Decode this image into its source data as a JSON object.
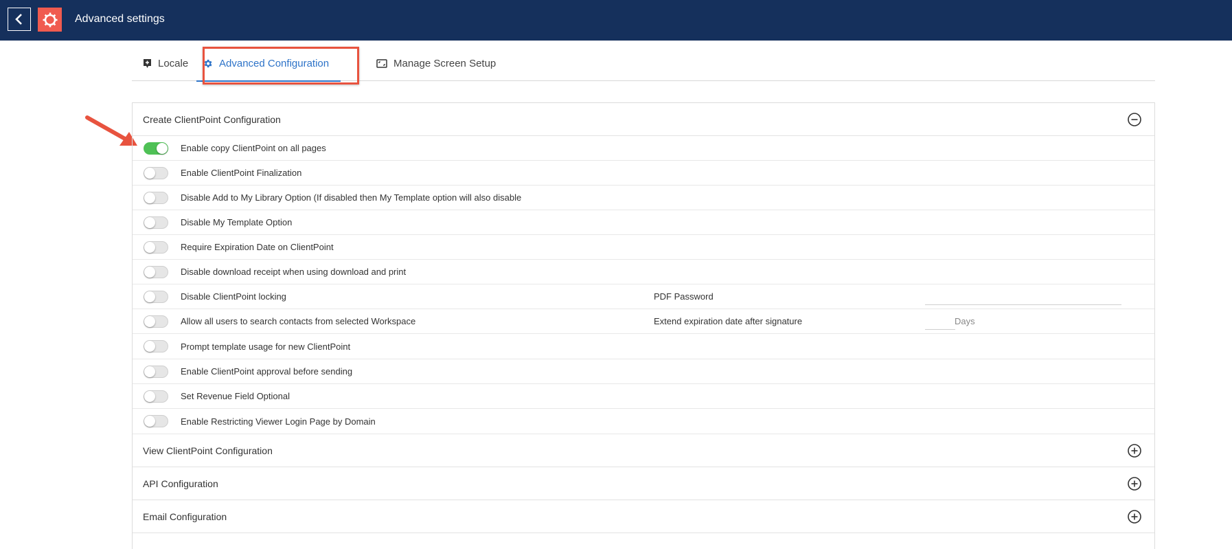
{
  "header": {
    "title": "Advanced settings",
    "bg_color": "#15305c",
    "logo_color": "#f05b4f"
  },
  "tabs": [
    {
      "label": "Locale",
      "icon": "locale-icon",
      "active": false
    },
    {
      "label": "Advanced Configuration",
      "icon": "gear-icon",
      "active": true
    },
    {
      "label": "Manage Screen Setup",
      "icon": "screen-icon",
      "active": false
    }
  ],
  "sections": {
    "create": {
      "title": "Create ClientPoint Configuration",
      "expanded": true,
      "rows": [
        {
          "label": "Enable copy ClientPoint on all pages",
          "on": true
        },
        {
          "label": "Enable ClientPoint Finalization",
          "on": false
        },
        {
          "label": "Disable Add to My Library Option (If disabled then My Template option will also disable",
          "on": false
        },
        {
          "label": "Disable My Template Option",
          "on": false
        },
        {
          "label": "Require Expiration Date on ClientPoint",
          "on": false
        },
        {
          "label": "Disable download receipt when using download and print",
          "on": false
        },
        {
          "label": "Disable ClientPoint locking",
          "on": false,
          "side_label": "PDF Password",
          "side_value": ""
        },
        {
          "label": "Allow all users to search contacts from selected Workspace",
          "on": false,
          "side_label": "Extend expiration date after signature",
          "side_value": "",
          "side_unit": "Days"
        },
        {
          "label": "Prompt template usage for new ClientPoint",
          "on": false
        },
        {
          "label": "Enable ClientPoint approval before sending",
          "on": false
        },
        {
          "label": "Set Revenue Field Optional",
          "on": false
        },
        {
          "label": "Enable Restricting Viewer Login Page by Domain",
          "on": false
        }
      ]
    },
    "view": {
      "title": "View ClientPoint Configuration",
      "expanded": false
    },
    "api": {
      "title": "API Configuration",
      "expanded": false
    },
    "email": {
      "title": "Email Configuration",
      "expanded": false
    }
  },
  "colors": {
    "accent": "#2d73c8",
    "toggle_on": "#4fc156",
    "highlight": "#e8533f"
  }
}
